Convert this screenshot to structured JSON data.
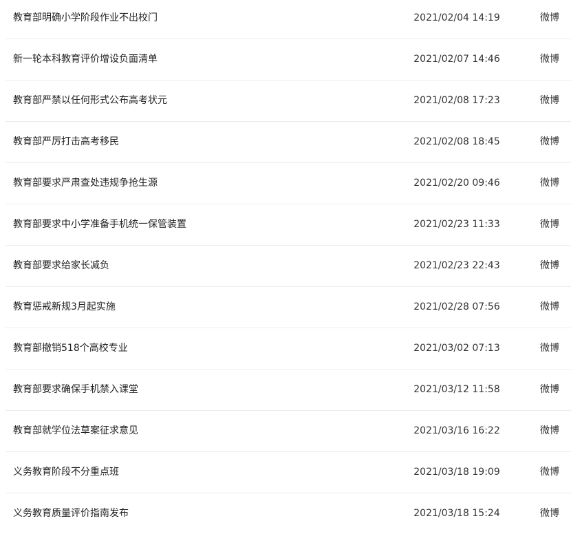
{
  "news_list": {
    "rows": [
      {
        "title": "教育部明确小学阶段作业不出校门",
        "time": "2021/02/04 14:19",
        "source": "微博"
      },
      {
        "title": "新一轮本科教育评价增设负面清单",
        "time": "2021/02/07 14:46",
        "source": "微博"
      },
      {
        "title": "教育部严禁以任何形式公布高考状元",
        "time": "2021/02/08 17:23",
        "source": "微博"
      },
      {
        "title": "教育部严厉打击高考移民",
        "time": "2021/02/08 18:45",
        "source": "微博"
      },
      {
        "title": "教育部要求严肃查处违规争抢生源",
        "time": "2021/02/20 09:46",
        "source": "微博"
      },
      {
        "title": "教育部要求中小学准备手机统一保管装置",
        "time": "2021/02/23 11:33",
        "source": "微博"
      },
      {
        "title": "教育部要求给家长减负",
        "time": "2021/02/23 22:43",
        "source": "微博"
      },
      {
        "title": "教育惩戒新规3月起实施",
        "time": "2021/02/28 07:56",
        "source": "微博"
      },
      {
        "title": "教育部撤销518个高校专业",
        "time": "2021/03/02 07:13",
        "source": "微博"
      },
      {
        "title": "教育部要求确保手机禁入课堂",
        "time": "2021/03/12 11:58",
        "source": "微博"
      },
      {
        "title": "教育部就学位法草案征求意见",
        "time": "2021/03/16 16:22",
        "source": "微博"
      },
      {
        "title": "义务教育阶段不分重点班",
        "time": "2021/03/18 19:09",
        "source": "微博"
      },
      {
        "title": "义务教育质量评价指南发布",
        "time": "2021/03/18 15:24",
        "source": "微博"
      }
    ]
  }
}
